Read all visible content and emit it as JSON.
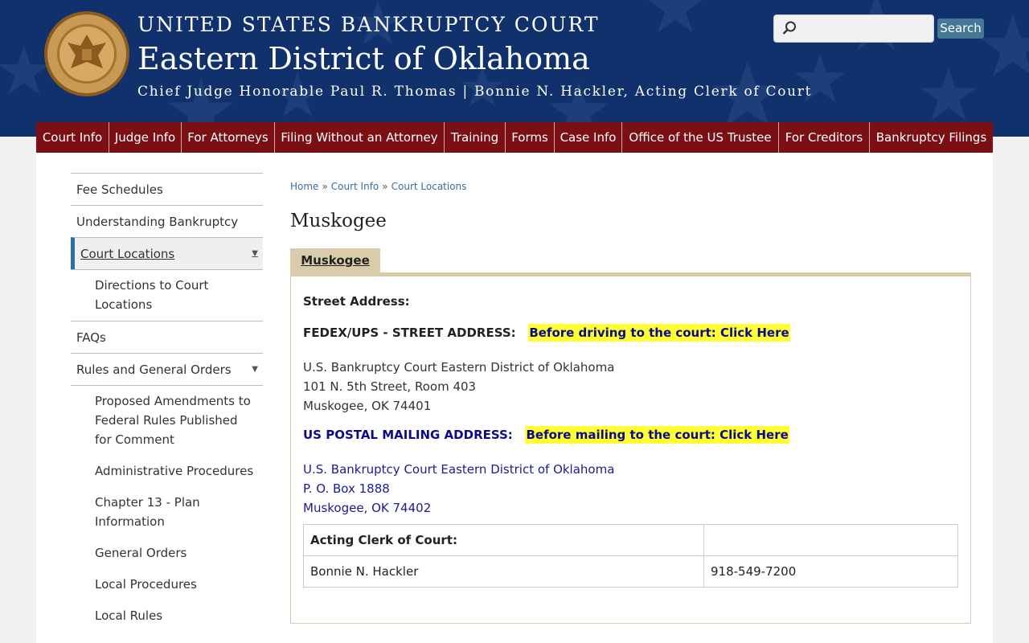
{
  "header": {
    "court_name": "UNITED STATES BANKRUPTCY COURT",
    "district_name": "Eastern District of Oklahoma",
    "judge_line": "Chief Judge Honorable Paul R. Thomas | Bonnie N. Hackler, Acting Clerk of Court",
    "seal_icon": "court-seal-icon",
    "search_placeholder": "",
    "search_button": "Search",
    "colors": {
      "banner": "#10316b",
      "nav": "#7a0f14",
      "search_button": "#467896"
    }
  },
  "nav": {
    "items": [
      "Court Info",
      "Judge Info",
      "For Attorneys",
      "Filing Without an Attorney",
      "Training",
      "Forms",
      "Case Info",
      "Office of the US Trustee",
      "For Creditors",
      "Bankruptcy Filings"
    ]
  },
  "sidebar": {
    "items": [
      {
        "label": "Fee Schedules"
      },
      {
        "label": "Understanding Bankruptcy"
      },
      {
        "label": "Court Locations",
        "active": true,
        "expand_icon": "triangle-down-icon"
      },
      {
        "label": "Directions to Court Locations",
        "sub": true
      },
      {
        "label": "FAQs"
      },
      {
        "label": "Rules and General Orders",
        "expand_icon": "triangle-down-icon"
      },
      {
        "label": "Proposed Amendments to Federal Rules Published for Comment",
        "sub": true
      },
      {
        "label": "Administrative Procedures",
        "sub": true
      },
      {
        "label": "Chapter 13 - Plan Information",
        "sub": true
      },
      {
        "label": "General Orders",
        "sub": true
      },
      {
        "label": "Local Procedures",
        "sub": true
      },
      {
        "label": "Local Rules",
        "sub": true
      }
    ]
  },
  "breadcrumb": [
    "Home",
    "Court Info",
    "Court Locations"
  ],
  "breadcrumb_sep": "»",
  "main": {
    "title": "Muskogee",
    "tab": "Muskogee",
    "street_label": "Street Address:",
    "fedex_label": "FEDEX/UPS - STREET ADDRESS:",
    "fedex_link": "Before driving to the court: Click Here",
    "street_lines": [
      "U.S. Bankruptcy Court Eastern District of Oklahoma",
      "101 N. 5th Street, Room 403",
      "Muskogee, OK 74401"
    ],
    "postal_label": "US POSTAL MAILING ADDRESS:",
    "postal_link": "Before mailing to the court: Click Here",
    "postal_lines": [
      "U.S. Bankruptcy Court Eastern District of Oklahoma",
      "P. O. Box 1888",
      "Muskogee, OK 74402"
    ],
    "table": {
      "header": [
        "Acting Clerk of Court:",
        ""
      ],
      "rows": [
        [
          "Bonnie N. Hackler",
          "918-549-7200"
        ]
      ]
    },
    "highlight_color": "#ffff33"
  }
}
